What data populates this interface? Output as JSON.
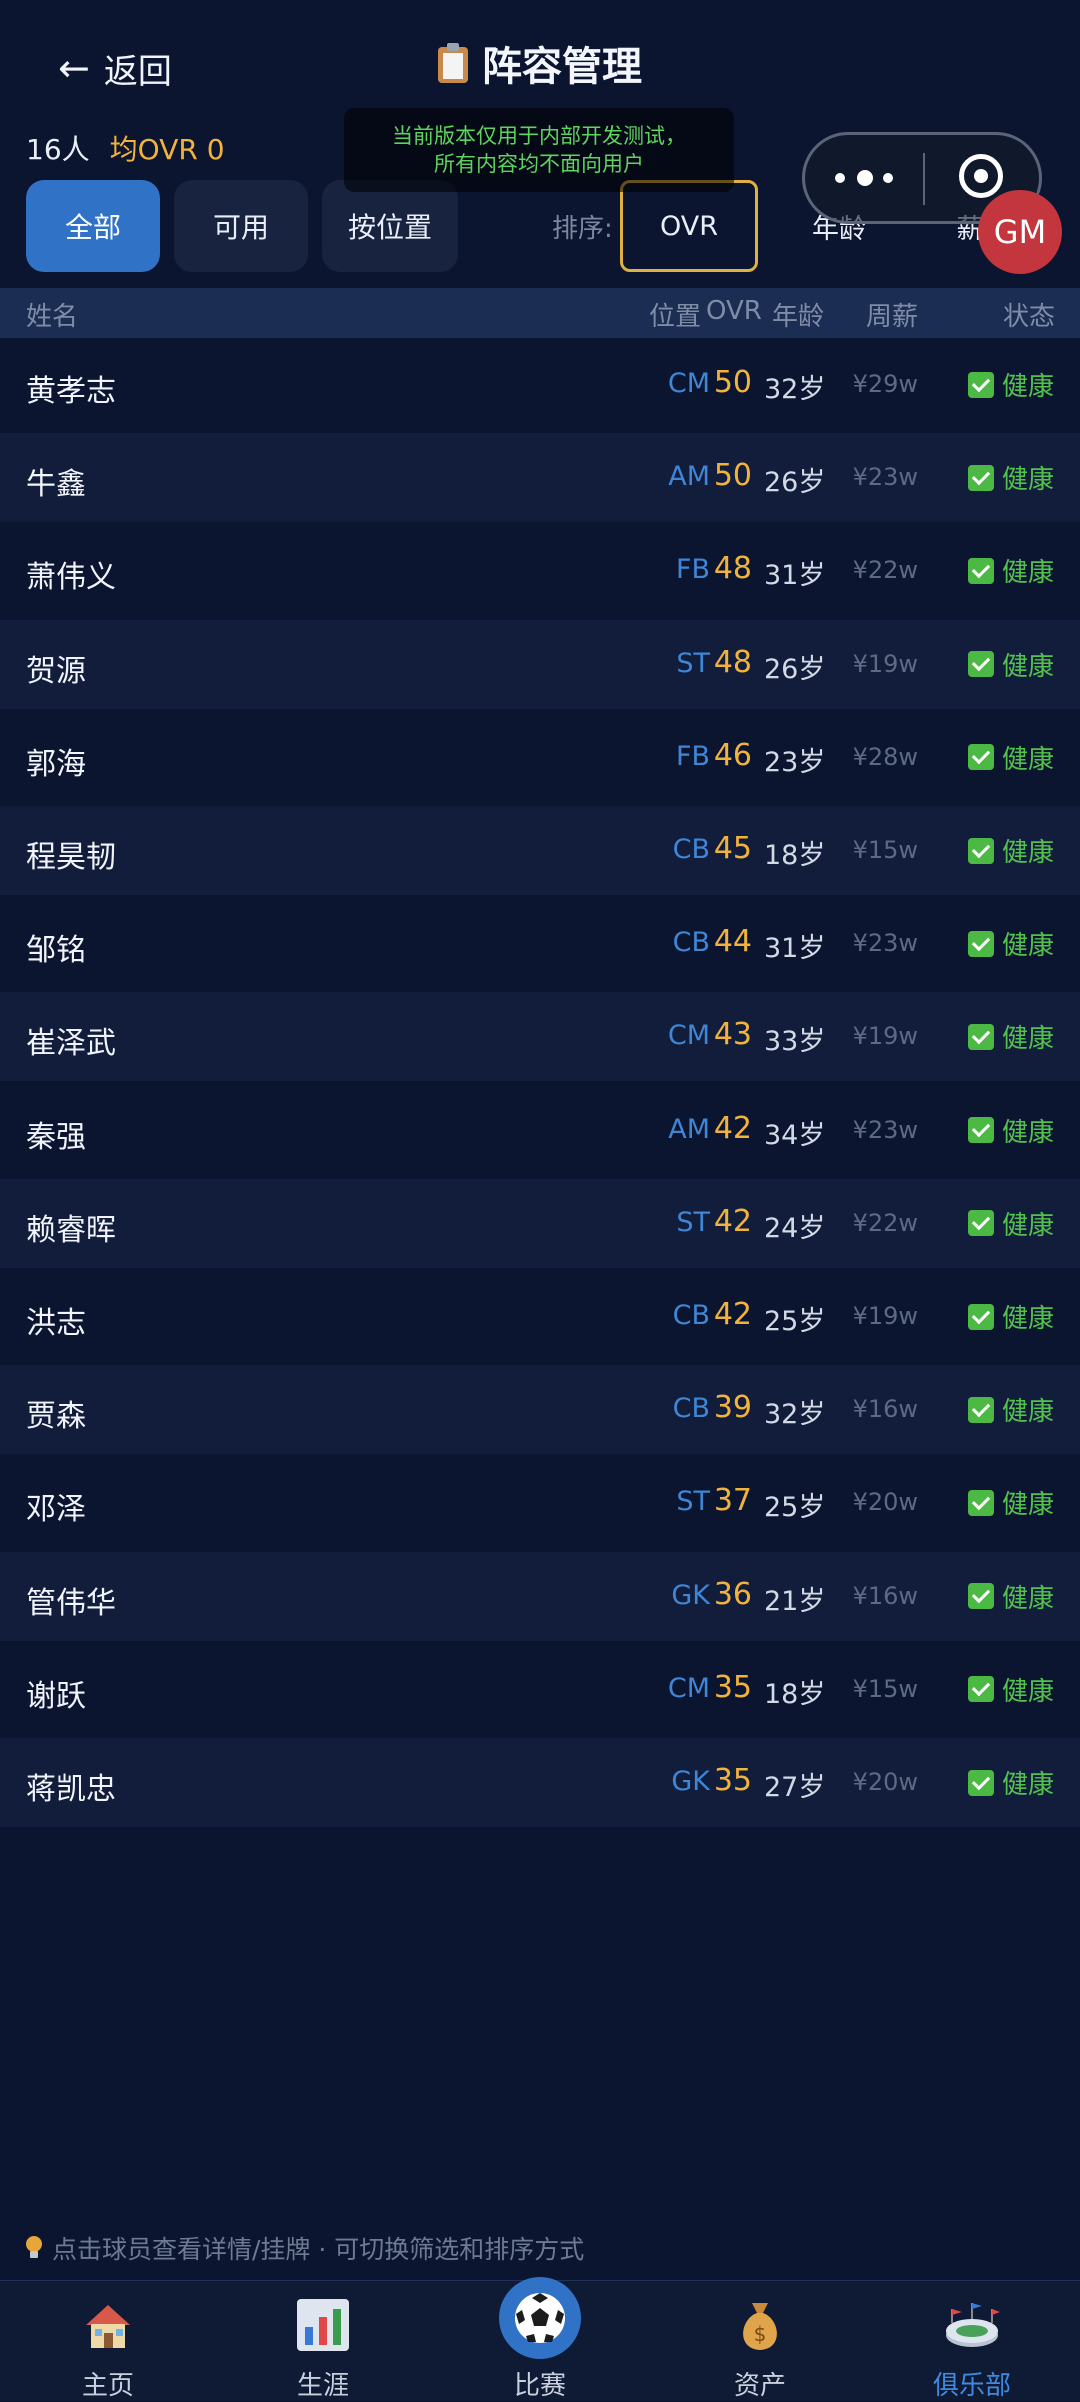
{
  "header": {
    "back_label": "返回",
    "title": "阵容管理",
    "notice": [
      "当前版本仅用于内部开发测试，",
      "所有内容均不面向用户"
    ],
    "gm_label": "GM"
  },
  "summary": {
    "count": "16人",
    "avg": "均OVR 0"
  },
  "filters": [
    "全部",
    "可用",
    "按位置"
  ],
  "sort": {
    "label": "排序:",
    "options": [
      "OVR",
      "年龄",
      "薪"
    ]
  },
  "table_headers": {
    "name": "姓名",
    "pos": "位置",
    "ovr": "OVR",
    "age": "年龄",
    "salary": "周薪",
    "status": "状态"
  },
  "players": [
    {
      "name": "黄孝志",
      "pos": "CM",
      "ovr": "50",
      "age": "32岁",
      "salary": "¥29w",
      "status": "健康"
    },
    {
      "name": "牛鑫",
      "pos": "AM",
      "ovr": "50",
      "age": "26岁",
      "salary": "¥23w",
      "status": "健康"
    },
    {
      "name": "萧伟义",
      "pos": "FB",
      "ovr": "48",
      "age": "31岁",
      "salary": "¥22w",
      "status": "健康"
    },
    {
      "name": "贺源",
      "pos": "ST",
      "ovr": "48",
      "age": "26岁",
      "salary": "¥19w",
      "status": "健康"
    },
    {
      "name": "郭海",
      "pos": "FB",
      "ovr": "46",
      "age": "23岁",
      "salary": "¥28w",
      "status": "健康"
    },
    {
      "name": "程昊韧",
      "pos": "CB",
      "ovr": "45",
      "age": "18岁",
      "salary": "¥15w",
      "status": "健康"
    },
    {
      "name": "邹铭",
      "pos": "CB",
      "ovr": "44",
      "age": "31岁",
      "salary": "¥23w",
      "status": "健康"
    },
    {
      "name": "崔泽武",
      "pos": "CM",
      "ovr": "43",
      "age": "33岁",
      "salary": "¥19w",
      "status": "健康"
    },
    {
      "name": "秦强",
      "pos": "AM",
      "ovr": "42",
      "age": "34岁",
      "salary": "¥23w",
      "status": "健康"
    },
    {
      "name": "赖睿晖",
      "pos": "ST",
      "ovr": "42",
      "age": "24岁",
      "salary": "¥22w",
      "status": "健康"
    },
    {
      "name": "洪志",
      "pos": "CB",
      "ovr": "42",
      "age": "25岁",
      "salary": "¥19w",
      "status": "健康"
    },
    {
      "name": "贾森",
      "pos": "CB",
      "ovr": "39",
      "age": "32岁",
      "salary": "¥16w",
      "status": "健康"
    },
    {
      "name": "邓泽",
      "pos": "ST",
      "ovr": "37",
      "age": "25岁",
      "salary": "¥20w",
      "status": "健康"
    },
    {
      "name": "管伟华",
      "pos": "GK",
      "ovr": "36",
      "age": "21岁",
      "salary": "¥16w",
      "status": "健康"
    },
    {
      "name": "谢跃",
      "pos": "CM",
      "ovr": "35",
      "age": "18岁",
      "salary": "¥15w",
      "status": "健康"
    },
    {
      "name": "蒋凯忠",
      "pos": "GK",
      "ovr": "35",
      "age": "27岁",
      "salary": "¥20w",
      "status": "健康"
    }
  ],
  "hint": "点击球员查看详情/挂牌 · 可切换筛选和排序方式",
  "nav": [
    {
      "label": "主页",
      "icon": "house-icon"
    },
    {
      "label": "生涯",
      "icon": "bar-chart-icon"
    },
    {
      "label": "比赛",
      "icon": "soccer-ball-icon"
    },
    {
      "label": "资产",
      "icon": "money-bag-icon"
    },
    {
      "label": "俱乐部",
      "icon": "stadium-icon"
    }
  ],
  "colors": {
    "accent": "#2f72c6",
    "ovr": "#f1b33c",
    "pos": "#3f86d6",
    "healthy": "#53c24c",
    "background": "#0b1530"
  }
}
